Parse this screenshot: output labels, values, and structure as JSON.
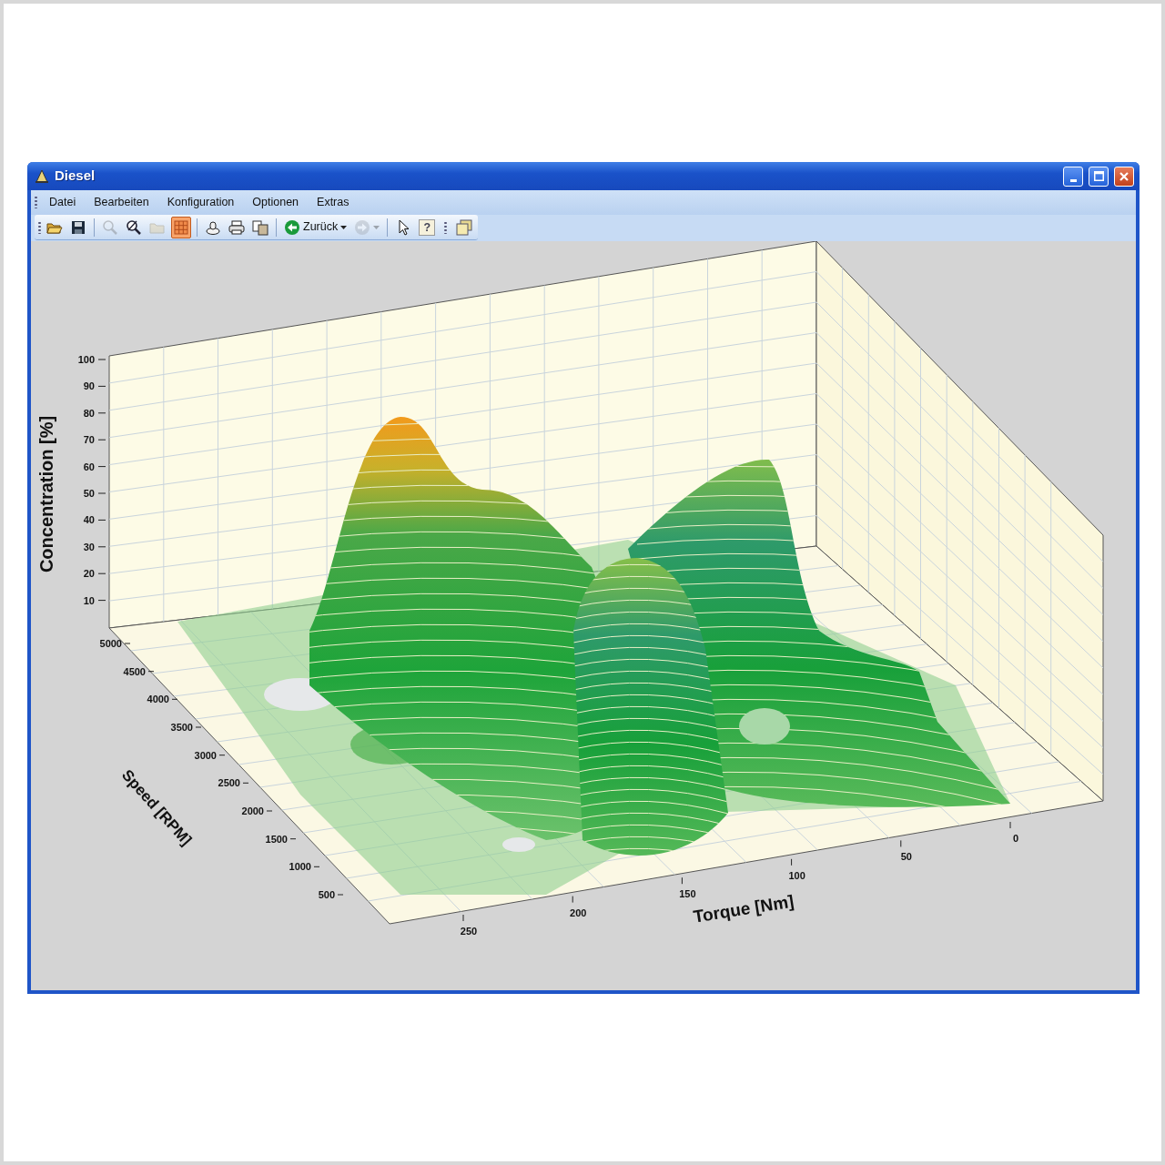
{
  "window": {
    "title": "Diesel"
  },
  "menu": [
    "Datei",
    "Bearbeiten",
    "Konfiguration",
    "Optionen",
    "Extras"
  ],
  "toolbar": [
    {
      "disabled": false,
      "selected": false
    },
    {
      "disabled": false,
      "selected": false
    },
    {
      "disabled": true,
      "selected": false
    },
    {
      "disabled": false,
      "selected": false
    },
    {
      "disabled": true,
      "selected": false
    },
    {
      "disabled": false,
      "selected": true
    },
    {
      "disabled": false,
      "selected": false
    },
    {
      "disabled": false,
      "selected": false
    },
    {
      "disabled": false,
      "selected": false
    },
    {
      "disabled": false,
      "selected": false,
      "label": "Zurück"
    },
    {
      "disabled": true,
      "selected": false
    },
    {
      "disabled": false,
      "selected": false
    },
    {
      "disabled": false,
      "selected": false,
      "label": "?"
    },
    {
      "disabled": false,
      "selected": false
    }
  ],
  "chart": {
    "z_axis": {
      "title": "Concentration [%]",
      "ticks": [
        "100",
        "90",
        "80",
        "70",
        "60",
        "50",
        "40",
        "30",
        "20",
        "10"
      ]
    },
    "y_axis": {
      "title": "Speed [RPM]",
      "ticks": [
        "5000",
        "4500",
        "4000",
        "3500",
        "3000",
        "2500",
        "2000",
        "1500",
        "1000",
        "500"
      ]
    },
    "x_axis": {
      "title": "Torque [Nm]",
      "ticks": [
        "250",
        "200",
        "150",
        "100",
        "50",
        "0"
      ]
    }
  }
}
